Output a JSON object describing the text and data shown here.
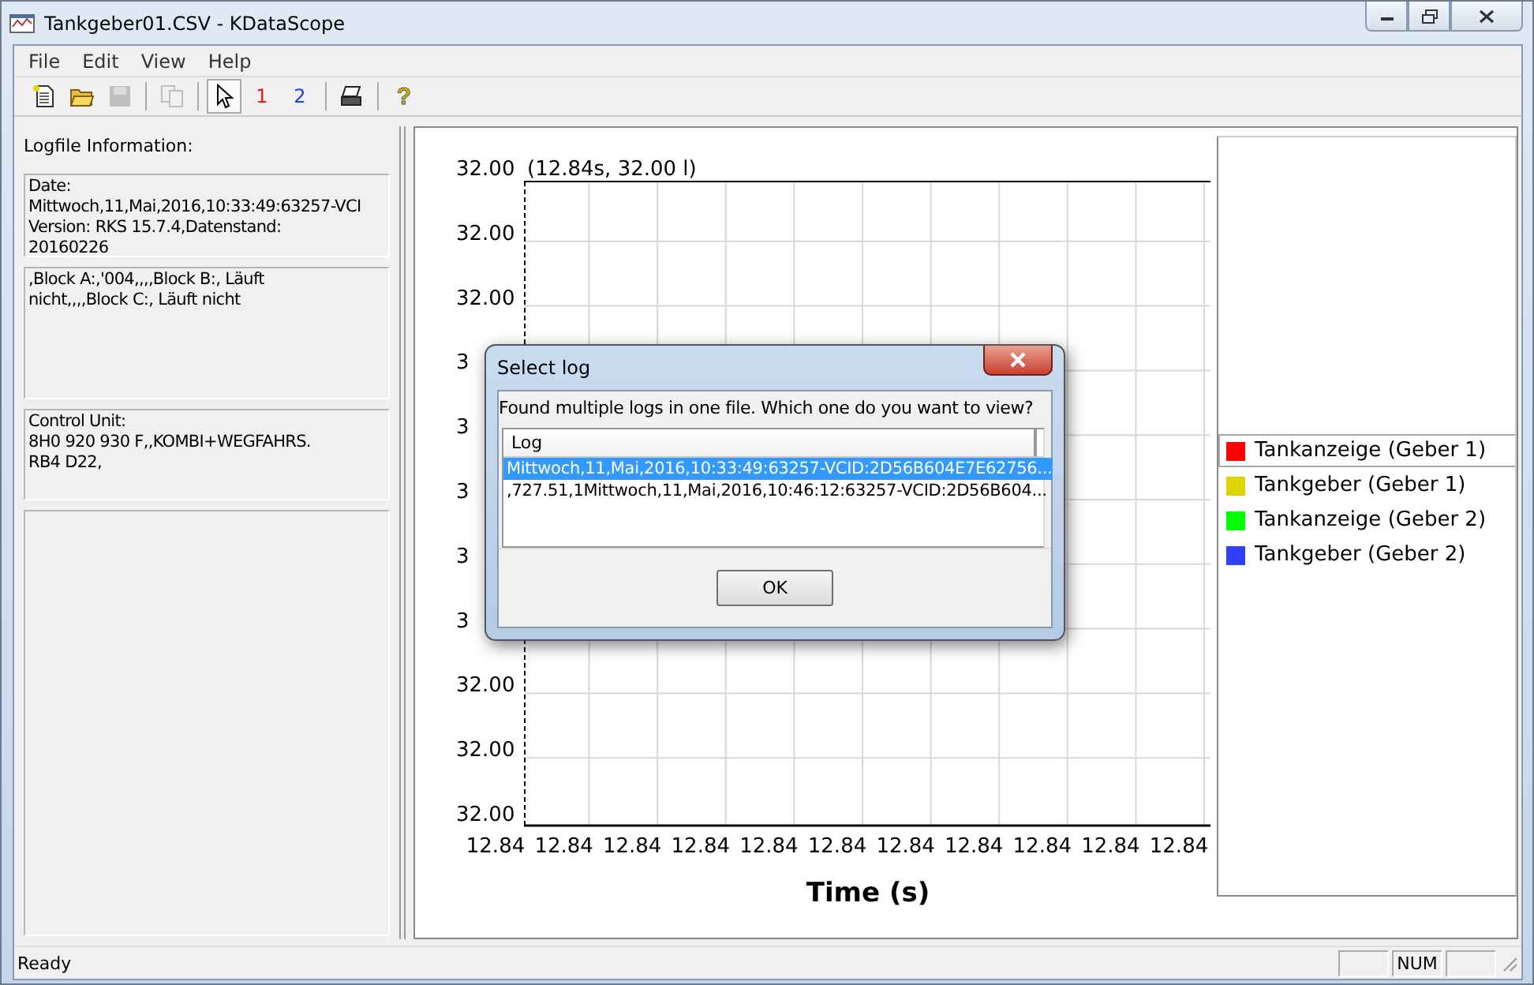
{
  "window": {
    "title": "Tankgeber01.CSV - KDataScope"
  },
  "menu": [
    {
      "label": "File"
    },
    {
      "label": "Edit"
    },
    {
      "label": "View"
    },
    {
      "label": "Help"
    }
  ],
  "toolbar": [
    {
      "kind": "new",
      "disabled": false,
      "selected": false
    },
    {
      "kind": "open",
      "disabled": false,
      "selected": false
    },
    {
      "kind": "save",
      "disabled": true,
      "selected": false
    },
    {
      "kind": "separator"
    },
    {
      "kind": "copy",
      "disabled": true,
      "selected": false
    },
    {
      "kind": "separator"
    },
    {
      "kind": "pointer",
      "disabled": false,
      "selected": true
    },
    {
      "kind": "marker",
      "label": "1",
      "color": "#e02020",
      "disabled": false,
      "selected": false
    },
    {
      "kind": "marker",
      "label": "2",
      "color": "#2040e0",
      "disabled": false,
      "selected": false
    },
    {
      "kind": "separator"
    },
    {
      "kind": "print",
      "disabled": false,
      "selected": false
    },
    {
      "kind": "separator"
    },
    {
      "kind": "help",
      "label": "?",
      "disabled": false,
      "selected": false
    }
  ],
  "logfile_info": {
    "heading": "Logfile Information:",
    "boxes": [
      "Date:\nMittwoch,11,Mai,2016,10:33:49:63257-VCI\nVersion: RKS 15.7.4,Datenstand:\n20160226",
      ",Block A:,'004,,,,Block B:, Läuft\nnicht,,,,Block C:, Läuft nicht",
      "Control Unit:\n8H0 920 930 F,,KOMBI+WEGFAHRS.\nRB4 D22,"
    ]
  },
  "chart": {
    "readout": "(12.84s, 32.00 l)",
    "y_tick_labels": [
      "32.00",
      "32.00",
      "32.00",
      "3",
      "3",
      "3",
      "3",
      "3",
      "32.00",
      "32.00",
      "32.00"
    ],
    "x_tick_labels": [
      "12.84",
      "12.84",
      "12.84",
      "12.84",
      "12.84",
      "12.84",
      "12.84",
      "12.84",
      "12.84",
      "12.84",
      "12.84"
    ],
    "xlabel": "Time (s)",
    "legend": [
      {
        "label": "Tankanzeige (Geber 1)",
        "color": "#ff0000",
        "selected": true
      },
      {
        "label": "Tankgeber (Geber 1)",
        "color": "#e0d400",
        "selected": false
      },
      {
        "label": "Tankanzeige (Geber 2)",
        "color": "#00ff00",
        "selected": false
      },
      {
        "label": "Tankgeber (Geber 2)",
        "color": "#3040ff",
        "selected": false
      }
    ]
  },
  "dialog": {
    "title": "Select log",
    "message": "Found multiple logs in one file. Which one do you want to view?",
    "column": "Log",
    "rows": [
      {
        "text": "Mittwoch,11,Mai,2016,10:33:49:63257-VCID:2D56B604E7E62756...",
        "selected": true
      },
      {
        "text": ",727.51,1Mittwoch,11,Mai,2016,10:46:12:63257-VCID:2D56B604...",
        "selected": false
      }
    ],
    "button": "OK"
  },
  "status_bar": {
    "text": "Ready",
    "panes": [
      "NUM"
    ]
  }
}
